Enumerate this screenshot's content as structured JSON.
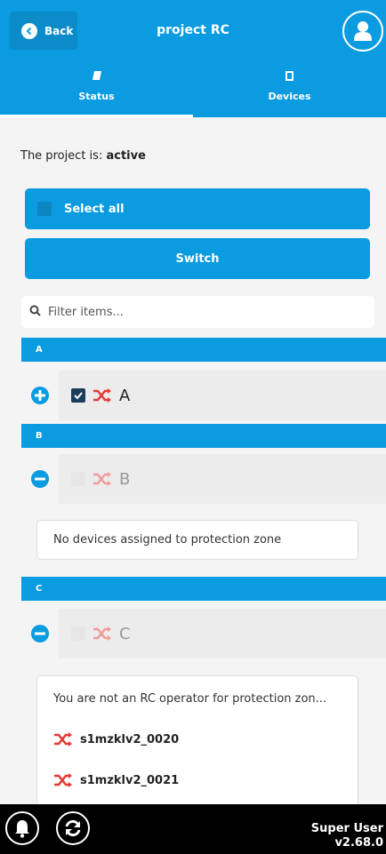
{
  "header": {
    "back_label": "Back",
    "title": "project RC",
    "accent_color": "#0a9be0"
  },
  "tabs": [
    {
      "label": "Status",
      "icon": "status-icon",
      "active": true
    },
    {
      "label": "Devices",
      "icon": "devices-icon",
      "active": false
    }
  ],
  "status": {
    "prefix": "The project is:",
    "value": "active"
  },
  "buttons": {
    "select_all": "Select all",
    "switch": "Switch"
  },
  "filter": {
    "placeholder": "Filter items..."
  },
  "groups": [
    {
      "header": "A",
      "expanded": true,
      "item_label": "A",
      "checked": true,
      "disabled": false
    },
    {
      "header": "B",
      "expanded": false,
      "item_label": "B",
      "checked": false,
      "disabled": true,
      "message": "No devices assigned to protection zone"
    },
    {
      "header": "C",
      "expanded": false,
      "item_label": "C",
      "checked": false,
      "disabled": true,
      "message": "You are not an RC operator for protection zon...",
      "devices": [
        "s1mzklv2_0020",
        "s1mzklv2_0021"
      ]
    }
  ],
  "footer": {
    "user_name": "Super User",
    "version": "v2.68.0"
  }
}
